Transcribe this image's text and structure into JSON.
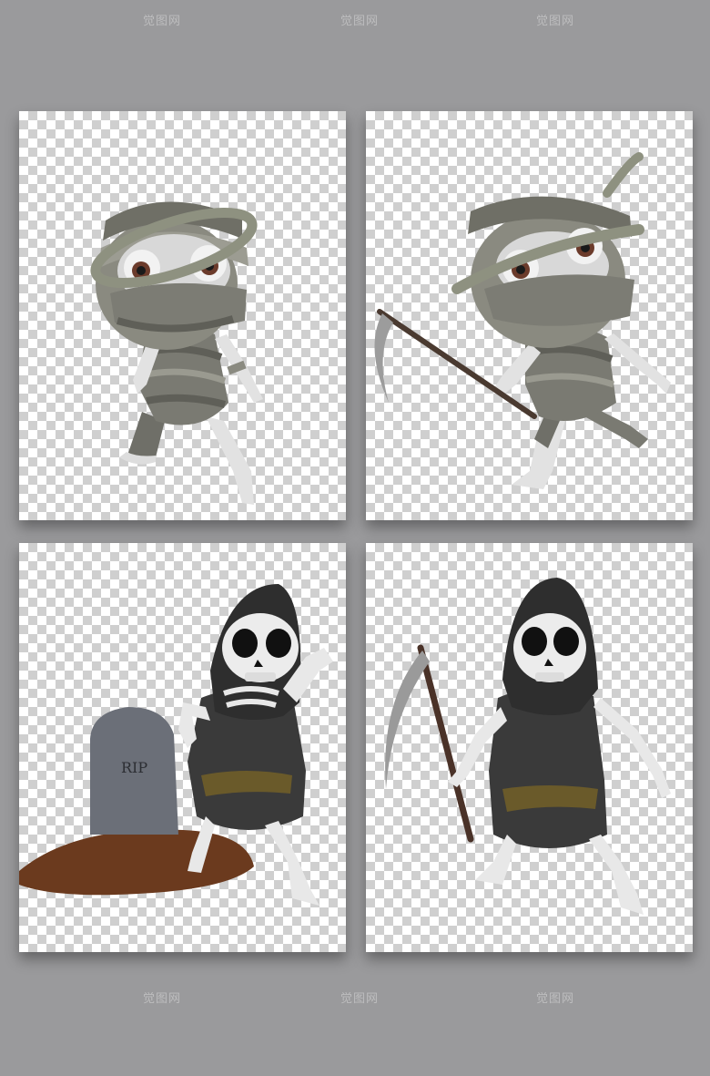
{
  "watermark": {
    "text": "觉图网"
  },
  "tombstone": {
    "text": "RIP"
  },
  "colors": {
    "background": "#9a9a9c",
    "checker_dark": "#cfcfcf",
    "checker_light": "#ffffff",
    "bandage": "#8a8a80",
    "bandage_dark": "#5f5f58",
    "robe": "#3a3a3a",
    "bone": "#e9e9e9",
    "soil": "#6b3a1e",
    "stone": "#6b6f78"
  },
  "cards": [
    {
      "subject": "mummy-standing"
    },
    {
      "subject": "mummy-with-scythe"
    },
    {
      "subject": "grim-reaper-at-grave"
    },
    {
      "subject": "grim-reaper-with-scythe"
    }
  ]
}
